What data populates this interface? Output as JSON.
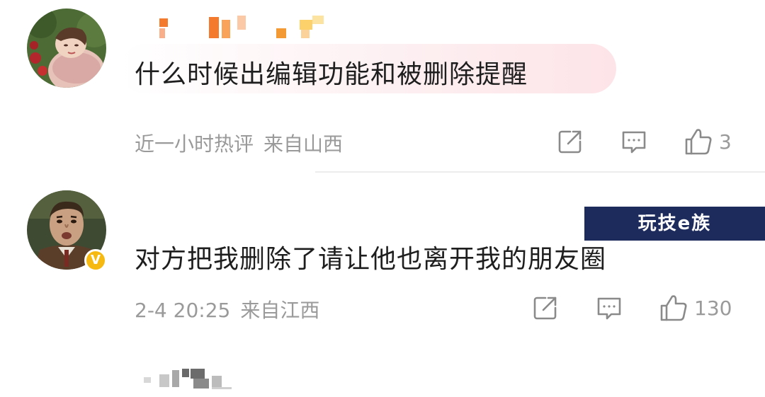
{
  "comments": [
    {
      "username": "",
      "avatar": "avatar-girl-with-apples",
      "text": "什么时候出编辑功能和被删除提醒",
      "time": "近一小时热评",
      "location": "来自山西",
      "likes": "3",
      "verified": false
    },
    {
      "username": "",
      "avatar": "avatar-mr-bean",
      "text": "对方把我删除了请让他也离开我的朋友圈",
      "time": "2-4 20:25",
      "location": "来自江西",
      "likes": "130",
      "verified": true,
      "badge": "V"
    }
  ],
  "icons": {
    "repost": "repost-icon",
    "comment": "comment-icon",
    "like": "thumbs-up-icon"
  },
  "colors": {
    "meta_text": "#9a9a9a",
    "bubble_pink": "#fde4e8",
    "badge_gold": "#f6b912",
    "watermark_bg": "#1d2a5c",
    "censor_orange": "#f47a2e"
  },
  "watermark": {
    "text": "玩技e族"
  }
}
